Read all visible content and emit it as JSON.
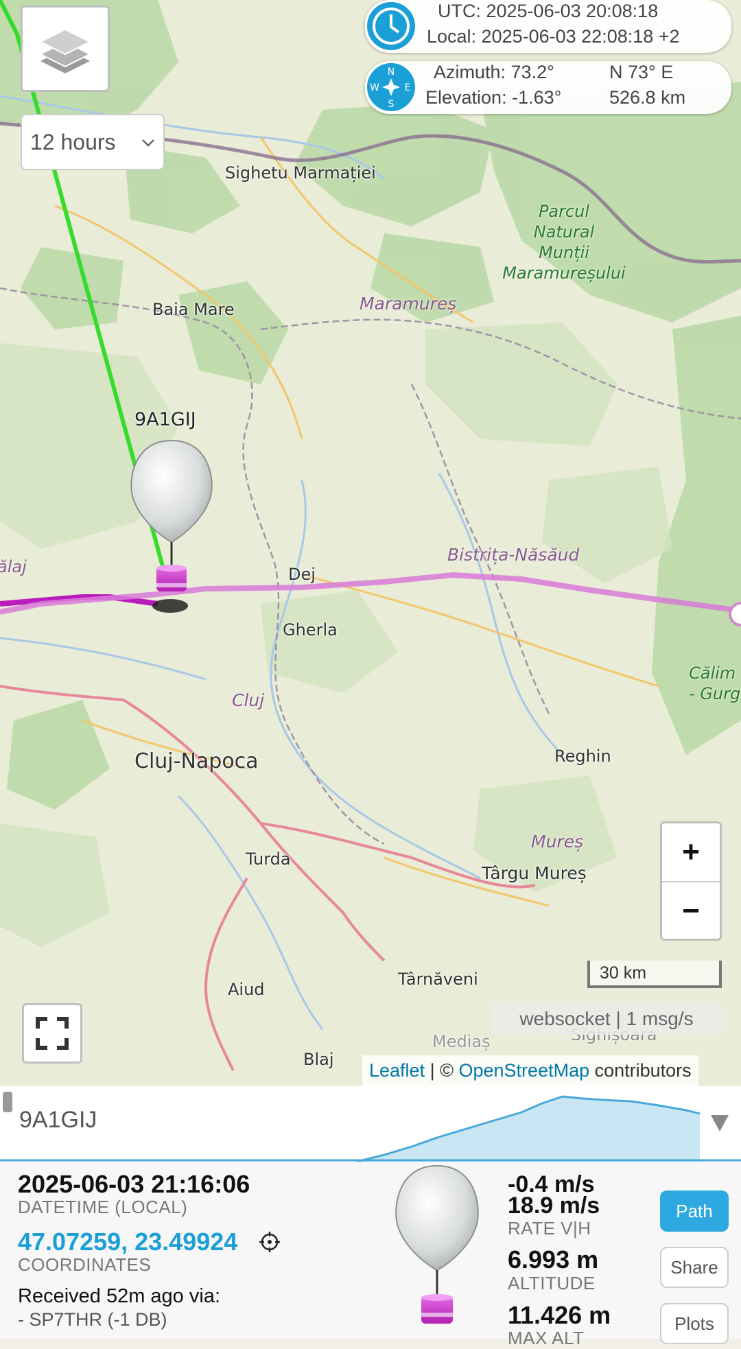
{
  "map": {
    "layers_icon": "layers-icon",
    "time_range": {
      "selected": "12 hours"
    },
    "time_box": {
      "icon": "clock-icon",
      "utc": "UTC: 2025-06-03 20:08:18",
      "local": "Local: 2025-06-03 22:08:18 +2"
    },
    "look_box": {
      "icon": "compass-icon",
      "compass_letters": {
        "n": "N",
        "e": "E",
        "s": "S",
        "w": "W"
      },
      "azimuth": "Azimuth: 73.2°",
      "elevation": "Elevation: -1.63°",
      "direction": "N 73° E",
      "range": "526.8 km"
    },
    "places": {
      "sighetu": "Sighetu Marmației",
      "baia_mare": "Baia Mare",
      "dej": "Dej",
      "gherla": "Gherla",
      "cluj_napoca": "Cluj-Napoca",
      "turda": "Turda",
      "reghin": "Reghin",
      "targu_mures": "Târgu Mureș",
      "tarnaveni": "Târnăveni",
      "aiud": "Aiud",
      "blaj": "Blaj",
      "sighisoara": "Sighișoara",
      "medias": "Mediaș",
      "salaj": "ălaj"
    },
    "regions": {
      "maramures": "Maramureș",
      "bistrita": "Bistrița-Năsăud",
      "cluj": "Cluj",
      "mures": "Mureș"
    },
    "park": {
      "line1": "Parcul",
      "line2": "Natural",
      "line3": "Munții",
      "line4": "Maramureșului"
    },
    "park2": {
      "line1": "Călim",
      "line2": "- Gurg"
    },
    "balloon_label": "9A1GIJ",
    "zoom_in": "+",
    "zoom_out": "−",
    "scale": "30 km",
    "status": "websocket | 1 msg/s",
    "attribution": {
      "leaflet": "Leaflet",
      "sep": " | © ",
      "osm": "OpenStreetMap",
      "rest": " contributors"
    }
  },
  "panel": {
    "callsign": "9A1GIJ",
    "collapse_icon": "triangle-down-icon",
    "datetime": "2025-06-03 21:16:06",
    "datetime_label": "DATETIME (LOCAL)",
    "coordinates": "47.07259, 23.49924",
    "coordinates_label": "COORDINATES",
    "received": "Received 52m ago via:",
    "receiver": "- SP7THR (-1 DB)",
    "rate_v": "-0.4 m/s",
    "rate_h": "18.9 m/s",
    "rate_label": "RATE V|H",
    "altitude": "6.993 m",
    "altitude_label": "ALTITUDE",
    "max_alt": "11.426 m",
    "max_alt_label": "MAX ALT",
    "buttons": {
      "path": "Path",
      "share": "Share",
      "plots": "Plots"
    }
  }
}
